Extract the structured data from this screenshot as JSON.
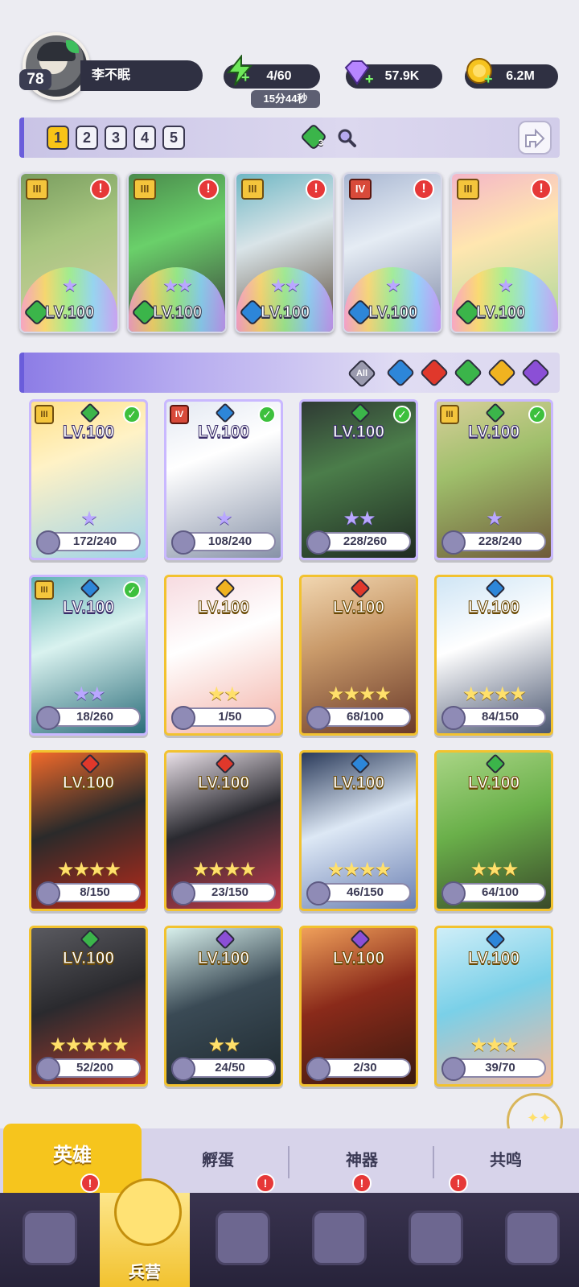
{
  "player": {
    "level": "78",
    "name": "李不眠"
  },
  "resources": {
    "energy": "4/60",
    "energy_timer": "15分44秒",
    "gems": "57.9K",
    "gold": "6.2M"
  },
  "team": {
    "slots": [
      "1",
      "2",
      "3",
      "4",
      "5"
    ],
    "active_slot": "1",
    "gem_count": "3",
    "heroes": [
      {
        "tier": "III",
        "level": "LV.100",
        "stars": "★",
        "element_color": "#3bb54a",
        "alert": "!"
      },
      {
        "tier": "III",
        "level": "LV.100",
        "stars": "★★",
        "element_color": "#3bb54a",
        "alert": "!"
      },
      {
        "tier": "III",
        "level": "LV.100",
        "stars": "★★",
        "element_color": "#2d86d9",
        "alert": "!"
      },
      {
        "tier": "IV",
        "level": "LV.100",
        "stars": "★",
        "element_color": "#2d86d9",
        "alert": "!"
      },
      {
        "tier": "III",
        "level": "LV.100",
        "stars": "★",
        "element_color": "#3bb54a",
        "alert": "!"
      }
    ]
  },
  "filters": {
    "all_label": "All",
    "elements": [
      {
        "name": "water",
        "color": "#2d86d9"
      },
      {
        "name": "fire",
        "color": "#e0382b"
      },
      {
        "name": "wind",
        "color": "#3bb54a"
      },
      {
        "name": "light",
        "color": "#f0b320"
      },
      {
        "name": "dark",
        "color": "#8b4fd6"
      }
    ]
  },
  "heroes": [
    {
      "rarity": "purple",
      "tier": "III",
      "level": "LV.100",
      "stars": "★",
      "fragments": "172/240",
      "element_color": "#3bb54a",
      "checked": true
    },
    {
      "rarity": "purple",
      "tier": "IV",
      "level": "LV.100",
      "stars": "★",
      "fragments": "108/240",
      "element_color": "#2d86d9",
      "checked": true
    },
    {
      "rarity": "purple",
      "tier": "",
      "level": "LV.100",
      "stars": "★★",
      "fragments": "228/260",
      "element_color": "#3bb54a",
      "checked": true
    },
    {
      "rarity": "purple",
      "tier": "III",
      "level": "LV.100",
      "stars": "★",
      "fragments": "228/240",
      "element_color": "#3bb54a",
      "checked": true
    },
    {
      "rarity": "purple",
      "tier": "III",
      "level": "LV.100",
      "stars": "★★",
      "fragments": "18/260",
      "element_color": "#2d86d9",
      "checked": true
    },
    {
      "rarity": "gold",
      "tier": "",
      "level": "LV.100",
      "stars": "★★",
      "fragments": "1/50",
      "element_color": "#f0b320",
      "checked": false
    },
    {
      "rarity": "gold",
      "tier": "",
      "level": "LV.100",
      "stars": "★★★★",
      "fragments": "68/100",
      "element_color": "#e0382b",
      "checked": false
    },
    {
      "rarity": "gold",
      "tier": "",
      "level": "LV.100",
      "stars": "★★★★",
      "fragments": "84/150",
      "element_color": "#2d86d9",
      "checked": false
    },
    {
      "rarity": "gold",
      "tier": "",
      "level": "LV.100",
      "stars": "★★★★",
      "fragments": "8/150",
      "element_color": "#e0382b",
      "checked": false
    },
    {
      "rarity": "gold",
      "tier": "",
      "level": "LV.100",
      "stars": "★★★★",
      "fragments": "23/150",
      "element_color": "#e0382b",
      "checked": false
    },
    {
      "rarity": "gold",
      "tier": "",
      "level": "LV.100",
      "stars": "★★★★",
      "fragments": "46/150",
      "element_color": "#2d86d9",
      "checked": false
    },
    {
      "rarity": "gold",
      "tier": "",
      "level": "LV.100",
      "stars": "★★★",
      "fragments": "64/100",
      "element_color": "#3bb54a",
      "checked": false
    },
    {
      "rarity": "gold",
      "tier": "",
      "level": "LV.100",
      "stars": "★★★★★",
      "fragments": "52/200",
      "element_color": "#3bb54a",
      "checked": false
    },
    {
      "rarity": "gold",
      "tier": "",
      "level": "LV.100",
      "stars": "★★",
      "fragments": "24/50",
      "element_color": "#8b4fd6",
      "checked": false
    },
    {
      "rarity": "gold",
      "tier": "",
      "level": "LV.100",
      "stars": "",
      "fragments": "2/30",
      "element_color": "#8b4fd6",
      "checked": false
    },
    {
      "rarity": "gold",
      "tier": "",
      "level": "LV.100",
      "stars": "★★★",
      "fragments": "39/70",
      "element_color": "#2d86d9",
      "checked": false
    }
  ],
  "tabs": [
    {
      "label": "英雄",
      "active": true
    },
    {
      "label": "孵蛋",
      "active": false
    },
    {
      "label": "神器",
      "active": false
    },
    {
      "label": "共鸣",
      "active": false
    }
  ],
  "nav": [
    {
      "icon": "cards-icon",
      "label": "",
      "alert": ""
    },
    {
      "icon": "barracks-icon",
      "label": "兵营",
      "alert": ""
    },
    {
      "icon": "map-book-icon",
      "label": "",
      "alert": "!"
    },
    {
      "icon": "castle-icon",
      "label": "",
      "alert": "!"
    },
    {
      "icon": "mushroom-guild-icon",
      "label": "",
      "alert": "!"
    },
    {
      "icon": "banner-icon",
      "label": "",
      "alert": ""
    }
  ],
  "first_nav_alert": "!"
}
